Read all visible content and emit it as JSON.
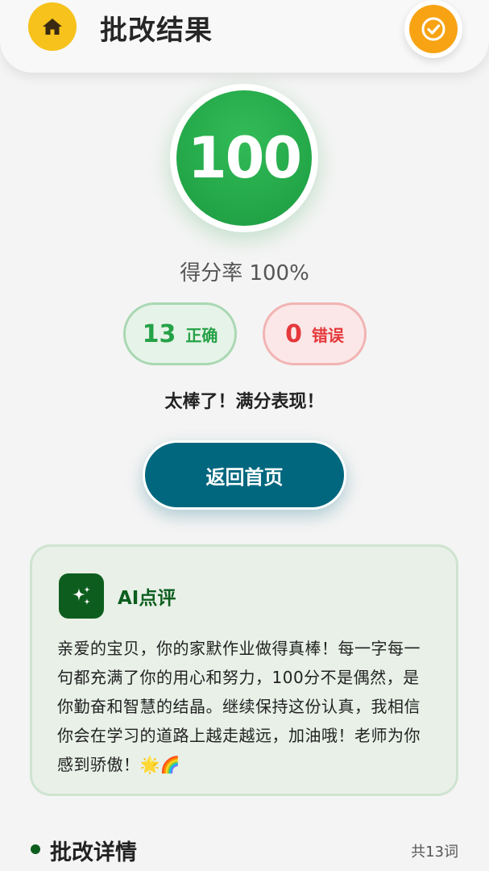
{
  "header": {
    "title": "批改结果",
    "home_icon": "home-icon",
    "check_icon": "check-circle-icon"
  },
  "score": {
    "value": "100",
    "rate_text": "得分率 100%"
  },
  "stats": {
    "correct_count": "13",
    "correct_label": "正确",
    "wrong_count": "0",
    "wrong_label": "错误"
  },
  "praise": "太棒了！满分表现！",
  "back_button": "返回首页",
  "ai_review": {
    "icon": "sparkles-icon",
    "title": "AI点评",
    "text": "亲爱的宝贝，你的家默作业做得真棒！每一字每一句都充满了你的用心和努力，100分不是偶然，是你勤奋和智慧的结晶。继续保持这份认真，我相信你会在学习的道路上越走越远，加油哦！老师为你感到骄傲！🌟🌈"
  },
  "details": {
    "title": "批改详情",
    "count": "共13词"
  },
  "colors": {
    "accent_green": "#22a547",
    "dark_green": "#0d5e1e",
    "teal": "#00677e",
    "wrong_red": "#e5383b",
    "home_yellow": "#f6c21b",
    "check_orange": "#f7a313"
  }
}
